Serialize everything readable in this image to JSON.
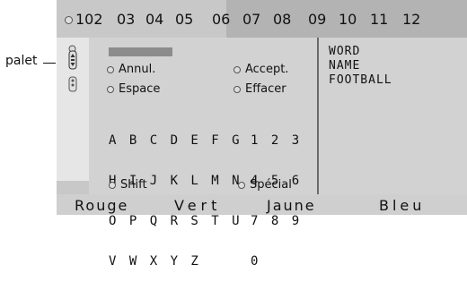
{
  "side_label": "palet",
  "tabs": [
    "102",
    "03",
    "04",
    "05",
    "06",
    "07",
    "08",
    "09",
    "10",
    "11",
    "12"
  ],
  "options": {
    "annul": "Annul.",
    "accept": "Accept.",
    "espace": "Espace",
    "effacer": "Effacer",
    "shift": "Shift",
    "special": "Spécial"
  },
  "keyboard": {
    "letters": [
      "A B C D E F G",
      "H I J K L M N",
      "O P Q R S T U",
      "V W X Y Z"
    ],
    "digits": [
      "1 2 3",
      "4 5 6",
      "7 8 9",
      "0"
    ]
  },
  "words": [
    "WORD",
    "NAME",
    "FOOTBALL"
  ],
  "colors": {
    "rouge": "Rouge",
    "vert": "Vert",
    "jaune": "Jaune",
    "bleu": "Bleu"
  },
  "icons": [
    "small-circle-icon",
    "remote-arrows-icon",
    "remote-icon"
  ]
}
